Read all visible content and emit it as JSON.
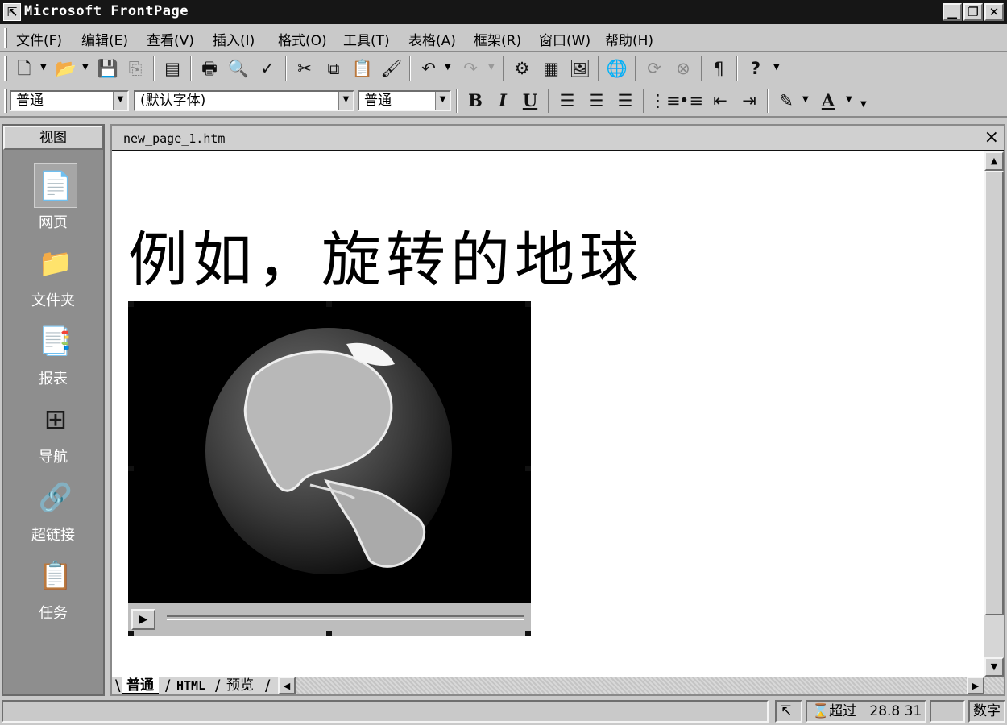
{
  "window": {
    "title": "Microsoft FrontPage",
    "app_icon": "frontpage-app-icon",
    "controls": [
      "minimize-icon",
      "restore-icon",
      "close-icon"
    ]
  },
  "menu": {
    "items": [
      {
        "label": "文件(F)"
      },
      {
        "label": "编辑(E)"
      },
      {
        "label": "查看(V)"
      },
      {
        "label": "插入(I)"
      },
      {
        "label": "格式(O)"
      },
      {
        "label": "工具(T)"
      },
      {
        "label": "表格(A)"
      },
      {
        "label": "框架(R)"
      },
      {
        "label": "窗口(W)"
      },
      {
        "label": "帮助(H)"
      }
    ]
  },
  "toolbar_standard": {
    "buttons": [
      "new-page-icon",
      "open-icon",
      "save-icon",
      "publish-icon",
      "folder-list-icon",
      "print-icon",
      "print-preview-icon",
      "spelling-icon",
      "cut-icon",
      "copy-icon",
      "paste-icon",
      "format-painter-icon",
      "undo-icon",
      "redo-icon",
      "insert-component-icon",
      "insert-table-icon",
      "insert-picture-icon",
      "hyperlink-icon",
      "refresh-icon",
      "stop-icon",
      "show-all-icon",
      "help-icon"
    ],
    "pilcrow_glyph": "¶",
    "help_glyph": "?"
  },
  "toolbar_formatting": {
    "style_value": "普通",
    "font_value": "(默认字体)",
    "size_value": "普通",
    "bold_label": "B",
    "italic_label": "I",
    "underline_label": "U",
    "font_color_label": "A"
  },
  "views_bar": {
    "header": "视图",
    "items": [
      {
        "label": "网页",
        "icon": "page-view-icon",
        "selected": true
      },
      {
        "label": "文件夹",
        "icon": "folders-view-icon",
        "selected": false
      },
      {
        "label": "报表",
        "icon": "reports-view-icon",
        "selected": false
      },
      {
        "label": "导航",
        "icon": "navigation-view-icon",
        "selected": false
      },
      {
        "label": "超链接",
        "icon": "hyperlinks-view-icon",
        "selected": false
      },
      {
        "label": "任务",
        "icon": "tasks-view-icon",
        "selected": false
      }
    ]
  },
  "document": {
    "filename": "new_page_1.htm",
    "close_glyph": "×",
    "heading": "例如，旋转的地球",
    "media": {
      "content": "rotating-earth-globe",
      "play_glyph": "▶"
    }
  },
  "view_tabs": [
    {
      "label": "普通",
      "active": true
    },
    {
      "label": "HTML",
      "active": false
    },
    {
      "label": "预览",
      "active": false
    }
  ],
  "status_bar": {
    "modem_text": "超过",
    "time_text": "28.8 31",
    "mode_text": "数字"
  }
}
